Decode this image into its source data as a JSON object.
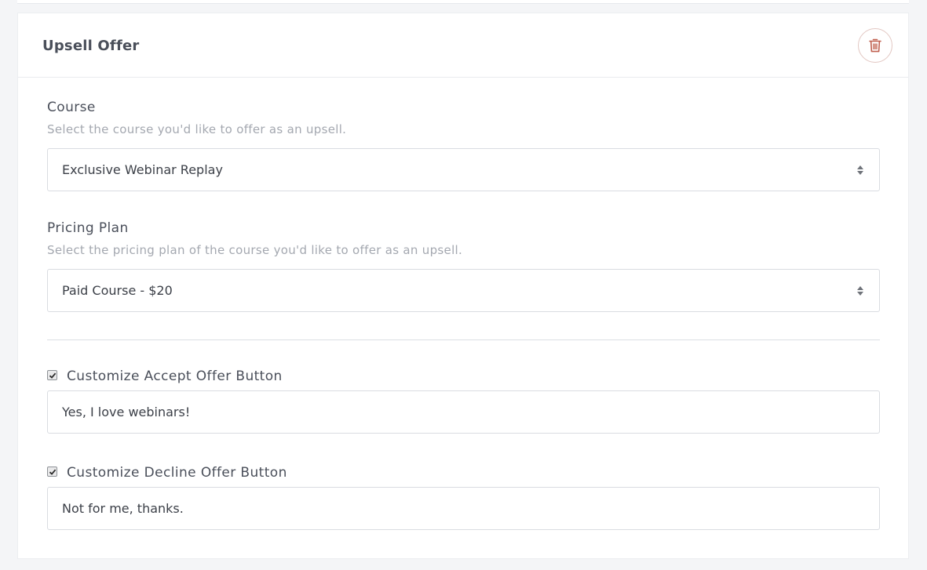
{
  "card": {
    "title": "Upsell Offer"
  },
  "icons": {
    "delete": "trash-icon",
    "select": "sort-arrows-icon",
    "check": "checkmark-icon"
  },
  "colors": {
    "delete_icon": "#c0604f",
    "delete_border": "#e2c7c2"
  },
  "course": {
    "label": "Course",
    "help": "Select the course you'd like to offer as an upsell.",
    "selected": "Exclusive Webinar Replay"
  },
  "pricing_plan": {
    "label": "Pricing Plan",
    "help": "Select the pricing plan of the course you'd like to offer as an upsell.",
    "selected": "Paid Course - $20"
  },
  "accept_button": {
    "checkbox_label": "Customize Accept Offer Button",
    "checked": true,
    "value": "Yes, I love webinars!"
  },
  "decline_button": {
    "checkbox_label": "Customize Decline Offer Button",
    "checked": true,
    "value": "Not for me, thanks."
  }
}
